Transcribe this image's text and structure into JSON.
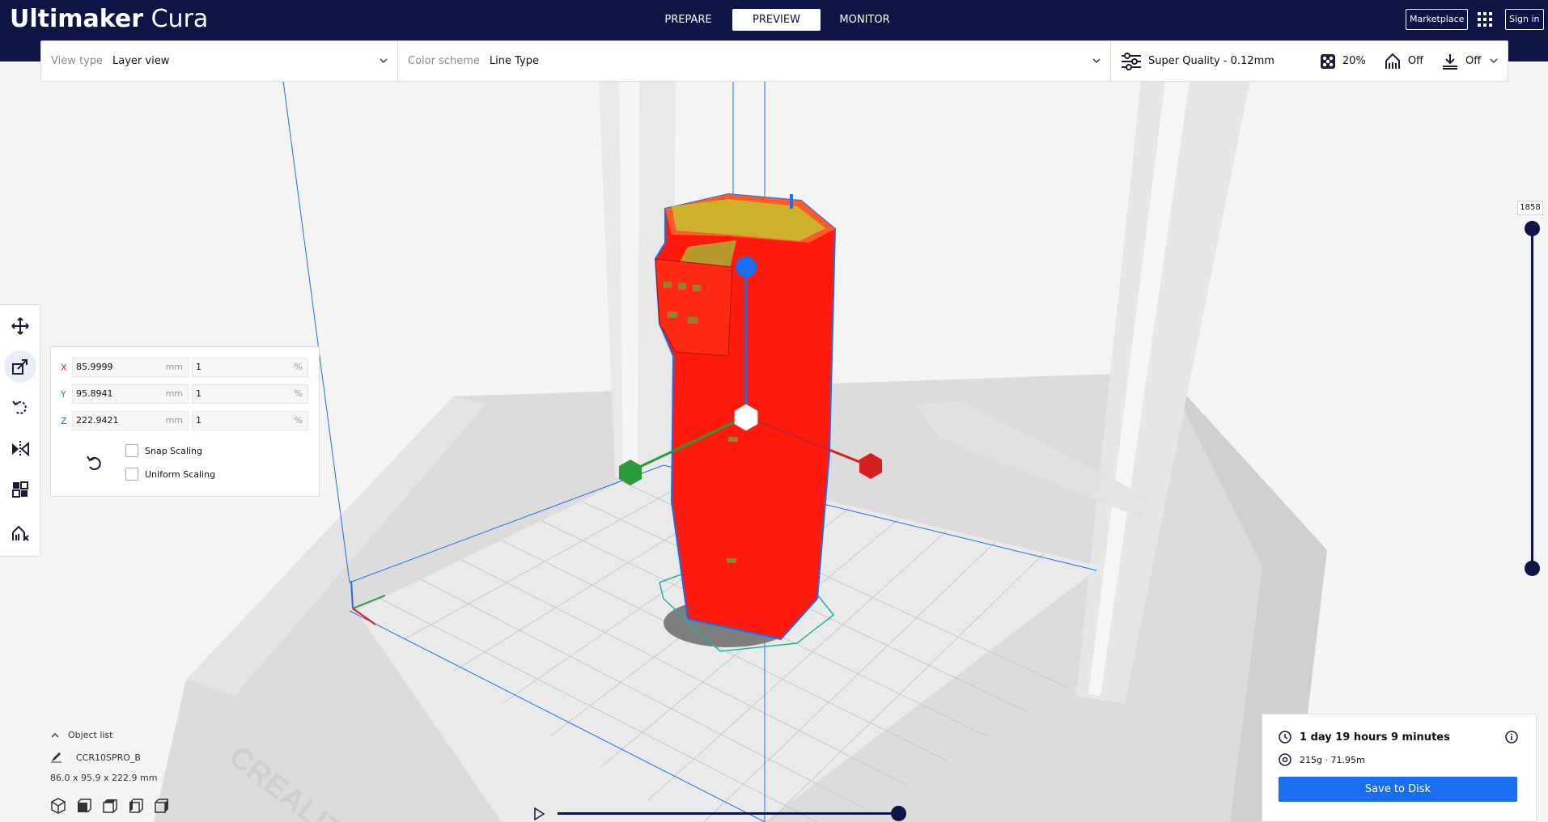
{
  "app": {
    "logo_bold": "Ultimaker",
    "logo_light": "Cura"
  },
  "stages": [
    {
      "label": "PREPARE"
    },
    {
      "label": "PREVIEW",
      "active": true
    },
    {
      "label": "MONITOR"
    }
  ],
  "header_buttons": {
    "marketplace": "Marketplace",
    "sign_in": "Sign in"
  },
  "top_bar": {
    "view_type_label": "View type",
    "view_type_value": "Layer view",
    "color_scheme_label": "Color scheme",
    "color_scheme_value": "Line Type",
    "quality": "Super Quality - 0.12mm",
    "infill": "20%",
    "support": "Off",
    "adhesion": "Off"
  },
  "scale_panel": {
    "x_label": "X",
    "x_mm": "85.9999",
    "x_pct": "1",
    "y_label": "Y",
    "y_mm": "95.8941",
    "y_pct": "1",
    "z_label": "Z",
    "z_mm": "222.9421",
    "z_pct": "1",
    "unit_mm": "mm",
    "unit_pct": "%",
    "snap_scaling": "Snap Scaling",
    "uniform_scaling": "Uniform Scaling"
  },
  "layer_slider": {
    "current_layer": "1858",
    "upper_fraction": 1.0,
    "lower_fraction": 0.0
  },
  "object_list": {
    "toggle_label": "Object list",
    "object_name": "CCR10SPRO_B",
    "dimensions": "86.0 x 95.9 x 222.9 mm"
  },
  "playback": {
    "progress_fraction": 1.0
  },
  "print_info": {
    "time": "1 day 19 hours 9 minutes",
    "material": "215g · 71.95m",
    "save_label": "Save to Disk"
  },
  "colors": {
    "header": "#0f1446",
    "accent": "#196ef0",
    "model": "#ff1a0d",
    "x_axis": "#d42020",
    "y_axis": "#2a9a3a",
    "z_axis": "#1a6ef0"
  },
  "scene": {
    "printer_brand_watermark": "CREALITY"
  }
}
